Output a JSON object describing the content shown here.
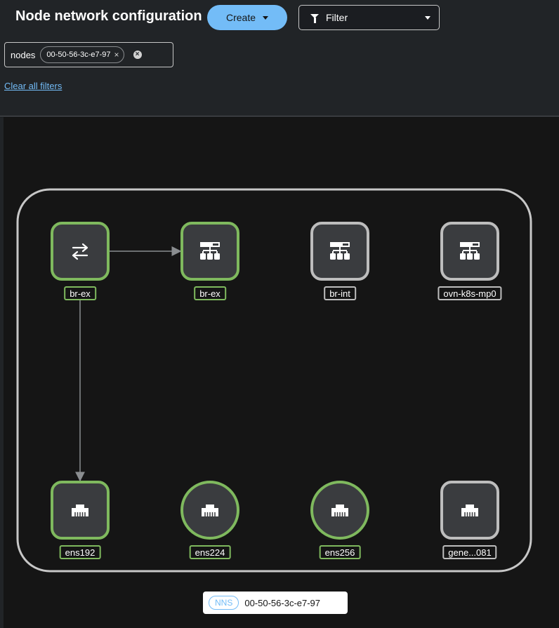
{
  "header": {
    "title": "Node network configuration",
    "create_label": "Create",
    "filter_label": "Filter"
  },
  "filters": {
    "category": "nodes",
    "chip_value": "00-50-56-3c-e7-97",
    "chip_close": "×",
    "group_clear": "×",
    "clear_all": "Clear all filters"
  },
  "topology": {
    "group": {
      "badge": "NNS",
      "name": "00-50-56-3c-e7-97"
    },
    "nodes": [
      {
        "id": "n1",
        "label": "br-ex",
        "kind": "bond",
        "status": "green",
        "shape": "rect"
      },
      {
        "id": "n2",
        "label": "br-ex",
        "kind": "bridge",
        "status": "green",
        "shape": "rect"
      },
      {
        "id": "n3",
        "label": "br-int",
        "kind": "bridge",
        "status": "gray",
        "shape": "rect"
      },
      {
        "id": "n4",
        "label": "ovn-k8s-mp0",
        "kind": "bridge",
        "status": "gray",
        "shape": "rect"
      },
      {
        "id": "n5",
        "label": "ens192",
        "kind": "ethernet",
        "status": "green",
        "shape": "rect"
      },
      {
        "id": "n6",
        "label": "ens224",
        "kind": "ethernet",
        "status": "green",
        "shape": "circle"
      },
      {
        "id": "n7",
        "label": "ens256",
        "kind": "ethernet",
        "status": "green",
        "shape": "circle"
      },
      {
        "id": "n8",
        "label": "gene...081",
        "kind": "ethernet",
        "status": "gray",
        "shape": "rect"
      }
    ],
    "edges": [
      {
        "from": "n1",
        "to": "n2"
      },
      {
        "from": "n1",
        "to": "n5"
      }
    ],
    "colors": {
      "green": "#7fb95e",
      "gray": "#bdbdbd",
      "node_fill": "#3a3c3f",
      "edge": "#8a8d90",
      "group_border": "#c7c7c7"
    }
  }
}
